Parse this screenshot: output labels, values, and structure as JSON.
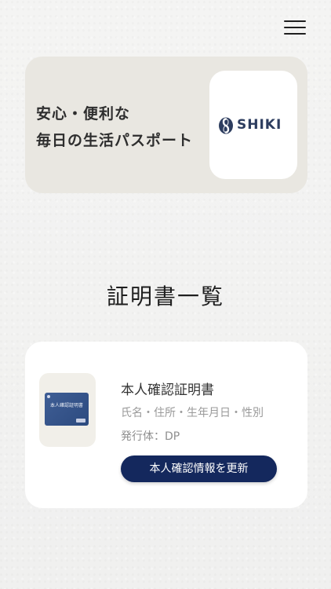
{
  "header": {
    "menu_icon": "hamburger-menu-icon"
  },
  "hero": {
    "tagline_line1": "安心・便利な",
    "tagline_line2": "毎日の生活パスポート",
    "logo_text": "SHIKI",
    "logo_color": "#2d3d5f"
  },
  "section": {
    "title": "証明書一覧"
  },
  "certificates": [
    {
      "name": "本人確認証明書",
      "fields": "氏名・住所・生年月日・性別",
      "issuer": "発行体：DP",
      "thumbnail_label": "本人確認証明書",
      "button_label": "本人確認情報を更新",
      "button_color": "#14285d"
    }
  ]
}
